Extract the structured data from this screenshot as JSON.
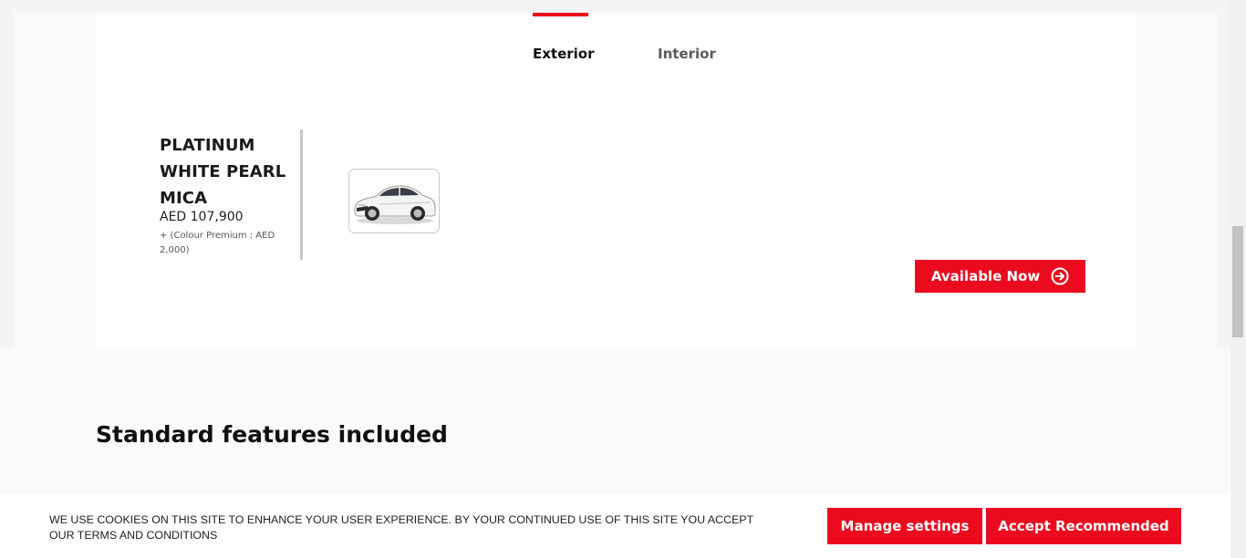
{
  "tabs": {
    "exterior": "Exterior",
    "interior": "Interior",
    "active": "Exterior"
  },
  "colour": {
    "name_lines": [
      "PLATINUM",
      "WHITE PEARL",
      "MICA"
    ],
    "price": "AED 107,900",
    "premium_note": "+ (Colour Premium : AED 2,000)",
    "swatch_icon": "car-thumbnail-white"
  },
  "availability": {
    "button_label": "Available Now",
    "icon": "arrow-right-circle-icon"
  },
  "features": {
    "heading": "Standard features included"
  },
  "cookie": {
    "text": "WE USE COOKIES ON THIS SITE TO ENHANCE YOUR USER EXPERIENCE. BY YOUR CONTINUED USE OF THIS SITE YOU ACCEPT OUR TERMS AND CONDITIONS",
    "manage_label": "Manage settings",
    "accept_label": "Accept Recommended"
  },
  "colors": {
    "brand_red": "#eb0a1e",
    "active_tab_text": "#111111",
    "inactive_tab_text": "#58595b",
    "card_background": "#ffffff",
    "page_background": "#f4f4f4"
  }
}
